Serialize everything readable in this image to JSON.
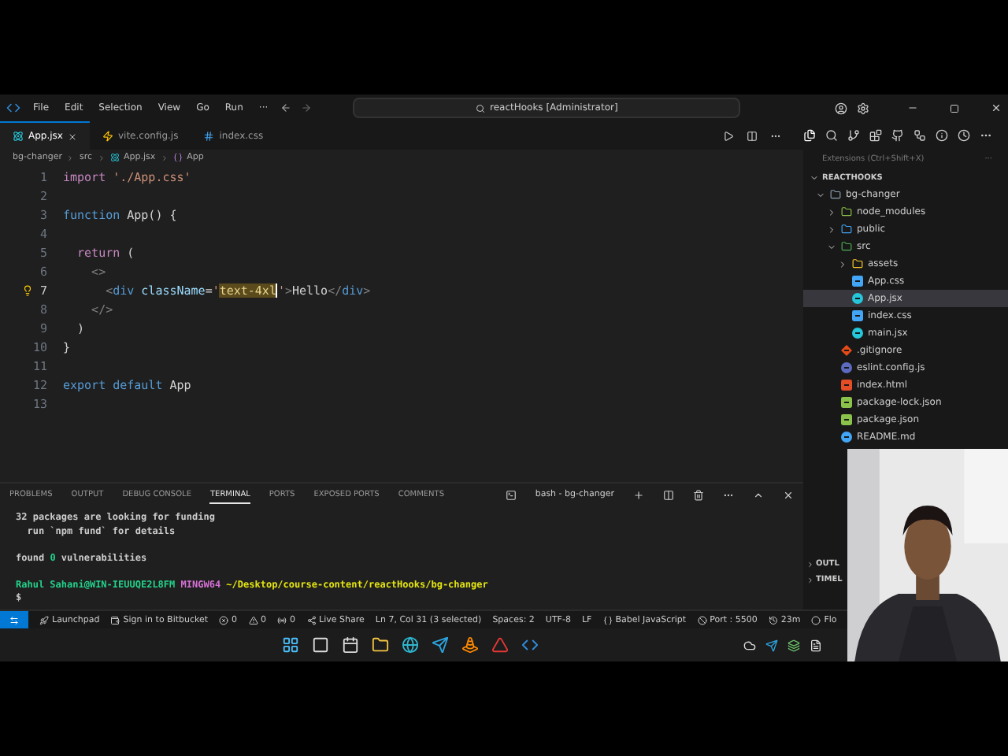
{
  "title_bar": {
    "menu": [
      "File",
      "Edit",
      "Selection",
      "View",
      "Go",
      "Run",
      "···"
    ],
    "command_center": "reactHooks [Administrator]"
  },
  "tabs": [
    {
      "label": "App.jsx",
      "kind": "react",
      "selected": true
    },
    {
      "label": "vite.config.js",
      "kind": "vite",
      "selected": false
    },
    {
      "label": "index.css",
      "kind": "css",
      "selected": false
    }
  ],
  "breadcrumb": [
    "bg-changer",
    "src",
    "App.jsx",
    "App"
  ],
  "editor": {
    "lines": [
      {
        "number": "1",
        "segments": [
          {
            "kind": "keyword",
            "text": "import"
          },
          {
            "kind": "string",
            "text": " './App.css'"
          }
        ]
      },
      {
        "number": "2"
      },
      {
        "number": "3",
        "segments": [
          {
            "kind": "storage",
            "text": "function"
          },
          {
            "kind": "plain",
            "text": " App() {"
          }
        ]
      },
      {
        "number": "4"
      },
      {
        "number": "5",
        "segments": [
          {
            "kind": "keyword",
            "text": "  return"
          },
          {
            "kind": "plain",
            "text": " ("
          }
        ]
      },
      {
        "number": "6",
        "segments": [
          {
            "kind": "punct",
            "text": "    <>"
          }
        ]
      },
      {
        "number": "7",
        "bulb": true,
        "segments": [
          {
            "kind": "punct",
            "text": "      <"
          },
          {
            "kind": "tag",
            "text": "div"
          },
          {
            "kind": "attr",
            "text": " className"
          },
          {
            "kind": "plain",
            "text": "="
          },
          {
            "kind": "string",
            "text": "'"
          },
          {
            "kind": "selected",
            "text": "text-4xl"
          },
          {
            "kind": "string",
            "text": "'"
          },
          {
            "kind": "punct",
            "text": ">"
          },
          {
            "kind": "plain",
            "text": "Hello"
          },
          {
            "kind": "punct",
            "text": "</"
          },
          {
            "kind": "tag",
            "text": "div"
          },
          {
            "kind": "punct",
            "text": ">"
          }
        ]
      },
      {
        "number": "8",
        "segments": [
          {
            "kind": "punct",
            "text": "    </>"
          }
        ]
      },
      {
        "number": "9",
        "segments": [
          {
            "kind": "plain",
            "text": "  )"
          }
        ]
      },
      {
        "number": "10",
        "segments": [
          {
            "kind": "plain",
            "text": "}"
          }
        ]
      },
      {
        "number": "11"
      },
      {
        "number": "12",
        "segments": [
          {
            "kind": "storage",
            "text": "export"
          },
          {
            "kind": "storage",
            "text": " default"
          },
          {
            "kind": "plain",
            "text": " App"
          }
        ]
      },
      {
        "number": "13"
      }
    ]
  },
  "sidebar": {
    "tooltip": "Extensions (Ctrl+Shift+X)",
    "more": "···",
    "section": "REACTHOOKS",
    "tree": [
      {
        "label": "bg-changer",
        "kind": "folder",
        "color": "#8da0b3",
        "expanded": true,
        "selected": false,
        "children": [
          {
            "label": "node_modules",
            "kind": "folder",
            "color": "#8bc34a",
            "expanded": false,
            "selected": false
          },
          {
            "label": "public",
            "kind": "folder",
            "color": "#42a5f5",
            "expanded": false,
            "selected": false
          },
          {
            "label": "src",
            "kind": "folder",
            "color": "#4caf50",
            "expanded": true,
            "selected": false,
            "children": [
              {
                "label": "assets",
                "kind": "folder",
                "color": "#ffca28",
                "expanded": false,
                "selected": false
              },
              {
                "label": "App.css",
                "kind": "css",
                "color": "#42a5f5",
                "selected": false
              },
              {
                "label": "App.jsx",
                "kind": "react",
                "color": "#26c6da",
                "selected": true
              },
              {
                "label": "index.css",
                "kind": "css",
                "color": "#42a5f5",
                "selected": false
              },
              {
                "label": "main.jsx",
                "kind": "react",
                "color": "#26c6da",
                "selected": false
              }
            ]
          },
          {
            "label": ".gitignore",
            "kind": "git",
            "color": "#e64a19",
            "selected": false
          },
          {
            "label": "eslint.config.js",
            "kind": "eslint",
            "color": "#5c6bc0",
            "selected": false
          },
          {
            "label": "index.html",
            "kind": "html",
            "color": "#e44d26",
            "selected": false
          },
          {
            "label": "package-lock.json",
            "kind": "json",
            "color": "#8bc34a",
            "selected": false
          },
          {
            "label": "package.json",
            "kind": "json",
            "color": "#8bc34a",
            "selected": false
          },
          {
            "label": "README.md",
            "kind": "info",
            "color": "#42a5f5",
            "selected": false
          }
        ]
      }
    ],
    "collapsed_sections": [
      "OUTL",
      "TIMEL"
    ]
  },
  "panel": {
    "tabs": [
      {
        "label": "PROBLEMS",
        "selected": false
      },
      {
        "label": "OUTPUT",
        "selected": false
      },
      {
        "label": "DEBUG CONSOLE",
        "selected": false
      },
      {
        "label": "TERMINAL",
        "selected": true
      },
      {
        "label": "PORTS",
        "selected": false
      },
      {
        "label": "EXPOSED PORTS",
        "selected": false
      },
      {
        "label": "COMMENTS",
        "selected": false
      }
    ],
    "terminal_name": "bash - bg-changer",
    "terminal_lines": [
      {
        "segments": [
          {
            "text": "32 packages are looking for funding",
            "color": "#cccccc"
          }
        ]
      },
      {
        "segments": [
          {
            "text": "  run `npm fund` for details",
            "color": "#cccccc"
          }
        ]
      },
      {
        "gap_before": true,
        "segments": [
          {
            "text": "found ",
            "color": "#cccccc"
          },
          {
            "text": "0",
            "color": "#23d18b"
          },
          {
            "text": " vulnerabilities",
            "color": "#cccccc"
          }
        ]
      },
      {
        "gap_before": true,
        "segments": [
          {
            "text": "Rahul Sahani@WIN-IEUUQE2L8FM",
            "color": "#23d18b"
          },
          {
            "text": " MINGW64",
            "color": "#d670d6"
          },
          {
            "text": " ~/Desktop/course-content/reactHooks/bg-changer",
            "color": "#e5e510"
          }
        ]
      },
      {
        "segments": [
          {
            "text": "$",
            "color": "#cccccc"
          }
        ]
      }
    ]
  },
  "status_bar": [
    {
      "kind": "remote"
    },
    {
      "kind": "rocket",
      "text": "Launchpad"
    },
    {
      "kind": "bitbucket",
      "text": "Sign in to Bitbucket"
    },
    {
      "kind": "error",
      "text": "0"
    },
    {
      "kind": "warning",
      "text": "0"
    },
    {
      "kind": "broadcast",
      "text": "0"
    },
    {
      "kind": "share",
      "text": "Live Share"
    },
    {
      "text": "Ln 7, Col 31 (3 selected)"
    },
    {
      "text": "Spaces: 2"
    },
    {
      "text": "UTF-8"
    },
    {
      "text": "LF"
    },
    {
      "kind": "braces",
      "text": "Babel JavaScript"
    },
    {
      "kind": "ban",
      "text": "Port : 5500"
    },
    {
      "kind": "history",
      "text": "23m"
    },
    {
      "kind": "circle",
      "text": "Flo"
    }
  ],
  "taskbar": {
    "apps": [
      {
        "kind": "start"
      },
      {
        "kind": "taskview"
      },
      {
        "kind": "calendar"
      },
      {
        "kind": "folder"
      },
      {
        "kind": "browser"
      },
      {
        "kind": "telegram"
      },
      {
        "kind": "cone"
      },
      {
        "kind": "triangle"
      },
      {
        "kind": "vscode"
      }
    ],
    "tray": [
      {
        "kind": "drive"
      },
      {
        "kind": "telegram"
      },
      {
        "kind": "stack"
      },
      {
        "kind": "notion"
      }
    ]
  }
}
